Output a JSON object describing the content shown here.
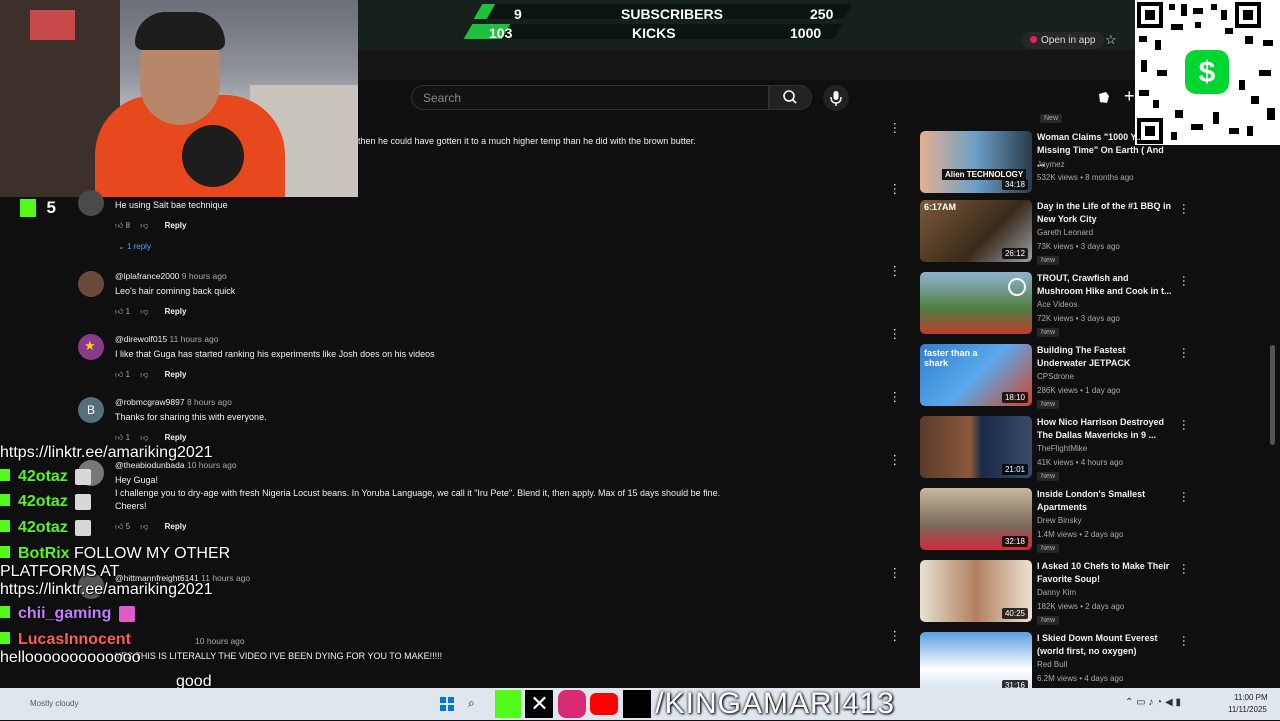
{
  "goal_banner": {
    "subscribers_label": "SUBSCRIBERS",
    "subscribers_current": "9",
    "subscribers_goal": "250",
    "subscribers_progress": 0.036,
    "kicks_label": "KICKS",
    "kicks_current": "103",
    "kicks_goal": "1000",
    "kicks_progress": 0.103
  },
  "youtube": {
    "open_in_app": "Open in app",
    "search_placeholder": "Search"
  },
  "kick_counter": "5",
  "comments": [
    {
      "text": "then he could have gotten it to a much higher temp than he did with the brown butter."
    },
    {
      "text": "He using Salt bae technique",
      "likes": "8",
      "reply_label": "Reply",
      "replies_label": "1 reply"
    },
    {
      "handle": "@lplafrance2000",
      "age": "9 hours ago",
      "text": "Leo's hair cominng back quick",
      "likes": "1",
      "reply_label": "Reply"
    },
    {
      "handle": "@direwolf015",
      "age": "11 hours ago",
      "text": "I like that Guga has started ranking his experiments like Josh does on his videos",
      "likes": "1",
      "reply_label": "Reply"
    },
    {
      "handle": "@robmcgraw9897",
      "age": "8 hours ago",
      "avatar_letter": "B",
      "text": "Thanks for sharing this with everyone.",
      "likes": "1",
      "reply_label": "Reply"
    },
    {
      "handle": "@theabiodunbada",
      "age": "10 hours ago",
      "lines": [
        "Hey Guga!",
        "I challenge you to dry-age with fresh Nigeria Locust beans. In Yoruba Language, we call it \"Iru Pete\". Blend it, then apply. Max of 15 days should be fine.",
        "Cheers!"
      ],
      "likes": "5",
      "reply_label": "Reply"
    },
    {
      "handle": "@hittmannfreight6141",
      "age": "11 hours ago"
    },
    {
      "age": "10 hours ago",
      "text": "YES THIS IS LITERALLY THE VIDEO I'VE BEEN DYING FOR YOU TO MAKE!!!!!"
    }
  ],
  "chat": [
    {
      "text": "https://linktr.ee/amariking2021"
    },
    {
      "user": "42otaz",
      "color": "#53fc18"
    },
    {
      "user": "42otaz",
      "color": "#53fc18"
    },
    {
      "user": "42otaz",
      "color": "#53fc18"
    },
    {
      "user": "BotRix",
      "color": "#53fc18",
      "text": "FOLLOW MY OTHER"
    },
    {
      "text": "PLATFORMS AT"
    },
    {
      "text": "https://linktr.ee/amariking2021"
    },
    {
      "user": "chii_gaming",
      "color": "#c77dff"
    },
    {
      "user": "LucasInnocent",
      "color": "#ff5c5c"
    },
    {
      "text": "hellooooooooooooo"
    },
    {
      "text": "good"
    }
  ],
  "sidebar": [
    {
      "title": "Woman Claims \"1000 Y... Missing Time\" On Earth ( And ...",
      "channel": "Jaymez",
      "stats": "532K views • 8 months ago",
      "duration": "34:18",
      "badge": "New",
      "thumb_text": "Alien TECHNOLOGY"
    },
    {
      "title": "Day in the Life of the #1 BBQ in New York City",
      "channel": "Gareth Leonard",
      "stats": "73K views • 3 days ago",
      "duration": "26:12",
      "badge": "New",
      "thumb_text": "6:17AM"
    },
    {
      "title": "TROUT, Crawfish and Mushroom Hike and Cook in t...",
      "channel": "Ace Videos",
      "stats": "72K views • 3 days ago",
      "duration": "",
      "badge": "New"
    },
    {
      "title": "Building The Fastest Underwater JETPACK",
      "channel": "CPSdrone",
      "stats": "286K views • 1 day ago",
      "duration": "18:10",
      "badge": "New",
      "thumb_text": "faster than a shark"
    },
    {
      "title": "How Nico Harrison Destroyed The Dallas Mavericks in 9 ...",
      "channel": "TheFlightMike",
      "stats": "41K views • 4 hours ago",
      "duration": "21:01",
      "badge": "New"
    },
    {
      "title": "Inside London's Smallest Apartments",
      "channel": "Drew Binsky",
      "stats": "1.4M views • 2 days ago",
      "duration": "32:18",
      "badge": "New"
    },
    {
      "title": "I Asked 10 Chefs to Make Their Favorite Soup!",
      "channel": "Danny Kim",
      "stats": "182K views • 2 days ago",
      "duration": "40:25",
      "badge": "New"
    },
    {
      "title": "I Skied Down Mount Everest (world first, no oxygen)",
      "channel": "Red Bull",
      "stats": "6.2M views • 4 days ago",
      "duration": "31:16",
      "badge": ""
    }
  ],
  "first_sidebar_badge": "New",
  "branding": {
    "handle": "/KINGAMARI413"
  },
  "taskbar": {
    "weather": "Mostly cloudy",
    "time": "11:00 PM",
    "date": "11/11/2025"
  }
}
